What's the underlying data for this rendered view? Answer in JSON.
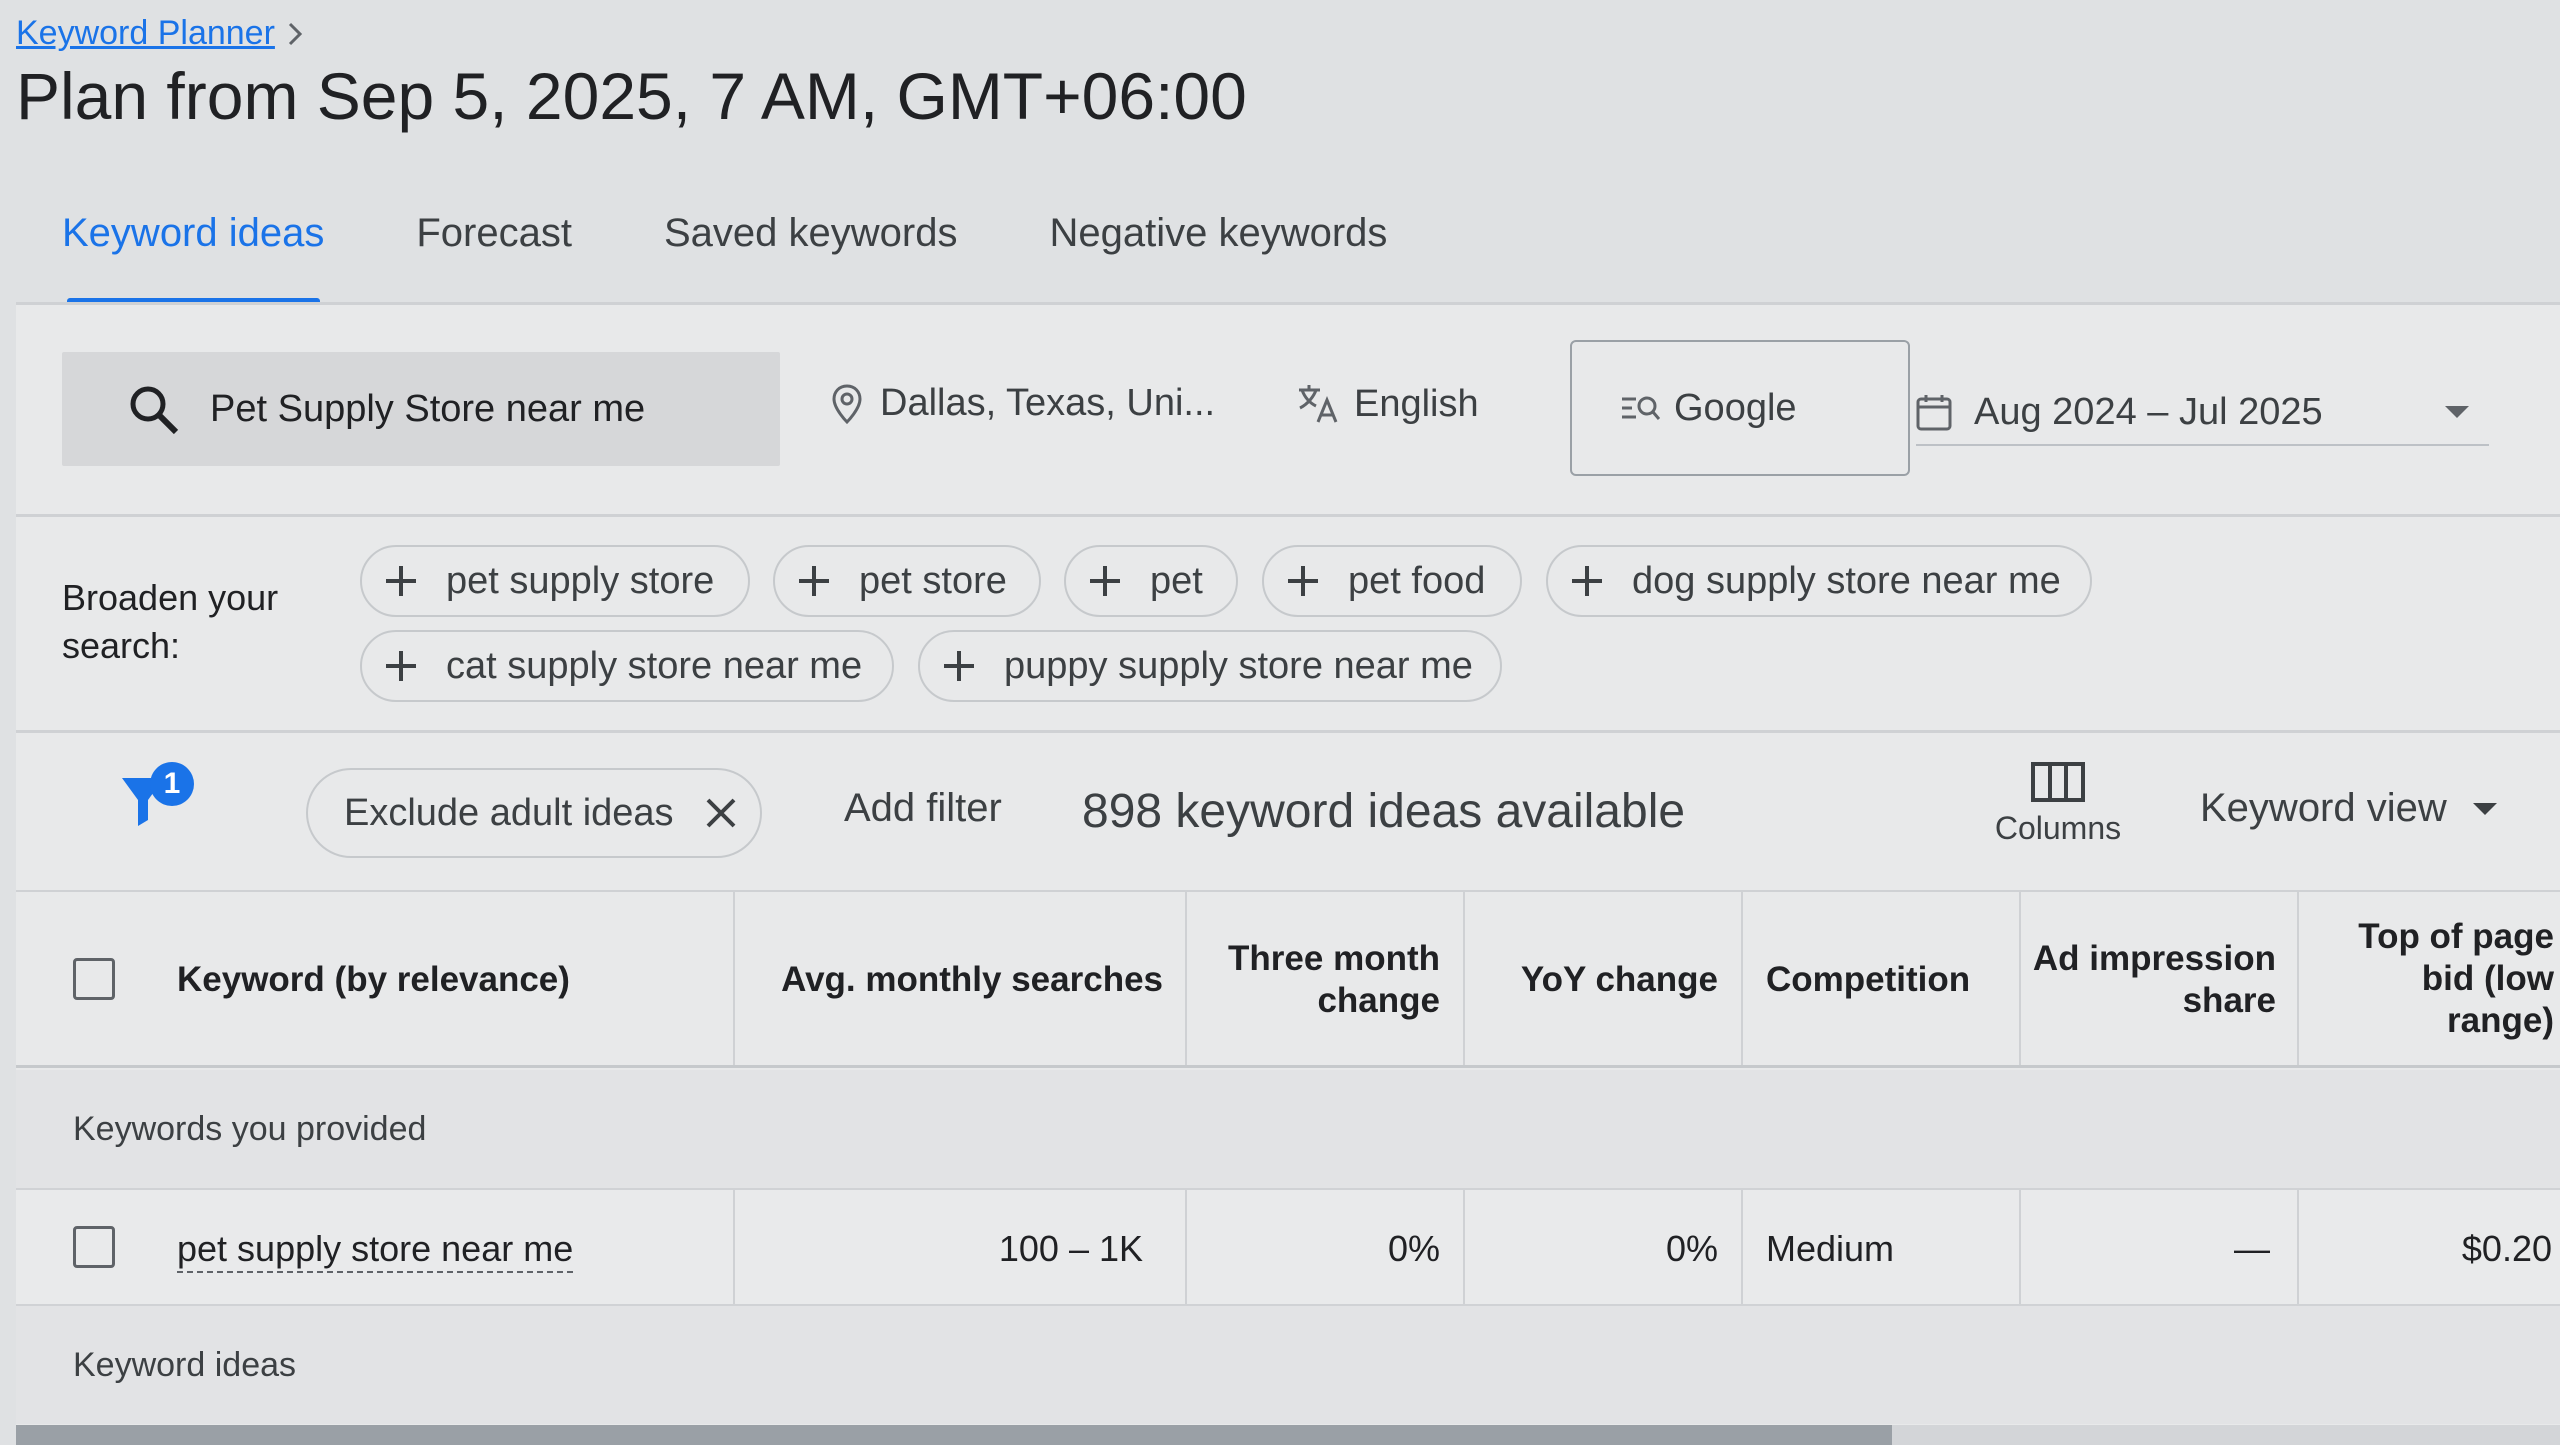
{
  "header": {
    "breadcrumb": "Keyword Planner",
    "title": "Plan from Sep 5, 2025, 7 AM, GMT+06:00"
  },
  "tabs": [
    {
      "label": "Keyword ideas",
      "active": true
    },
    {
      "label": "Forecast",
      "active": false
    },
    {
      "label": "Saved keywords",
      "active": false
    },
    {
      "label": "Negative keywords",
      "active": false
    }
  ],
  "search": {
    "query": "Pet Supply Store near me",
    "location": "Dallas, Texas, Uni...",
    "language": "English",
    "network": "Google",
    "date_range": "Aug 2024 – Jul 2025"
  },
  "broaden": {
    "label_line1": "Broaden your",
    "label_line2": "search:",
    "chips": [
      "pet supply store",
      "pet store",
      "pet",
      "pet food",
      "dog supply store near me",
      "cat supply store near me",
      "puppy supply store near me"
    ]
  },
  "filters": {
    "badge_count": "1",
    "active_filter": "Exclude adult ideas",
    "add_filter": "Add filter",
    "ideas_count": "898 keyword ideas available",
    "columns_label": "Columns",
    "view_label": "Keyword view"
  },
  "table": {
    "headers": {
      "keyword": "Keyword (by relevance)",
      "avg": "Avg. monthly searches",
      "three_month_1": "Three month",
      "three_month_2": "change",
      "yoy": "YoY change",
      "competition": "Competition",
      "ad_impr_1": "Ad impression",
      "ad_impr_2": "share",
      "top_bid_1": "Top of page",
      "top_bid_2": "bid (low",
      "top_bid_3": "range)"
    },
    "group_provided": "Keywords you provided",
    "rows": [
      {
        "keyword": "pet supply store near me",
        "avg": "100 – 1K",
        "three_month": "0%",
        "yoy": "0%",
        "competition": "Medium",
        "ad_impr": "—",
        "top_bid": "$0.20"
      }
    ],
    "group_ideas": "Keyword ideas"
  },
  "colors": {
    "accent": "#1a73e8",
    "background": "#dfe1e3"
  }
}
